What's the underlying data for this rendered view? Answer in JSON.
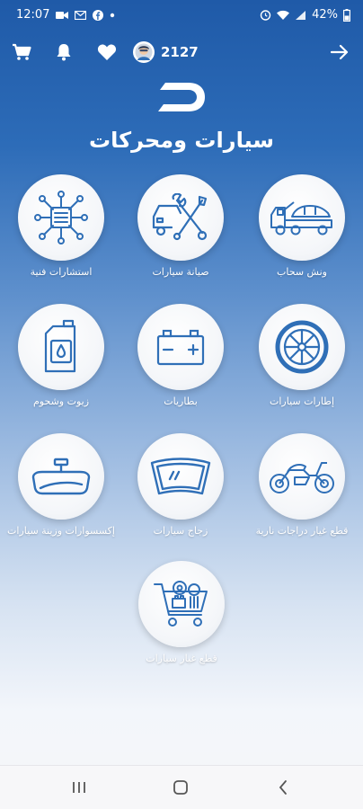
{
  "status": {
    "time": "12:07",
    "battery": "42%"
  },
  "header": {
    "points": "2127"
  },
  "page": {
    "title": "سيارات ومحركات"
  },
  "colors": {
    "accent": "#2d6cb8",
    "icon_stroke": "#2f6fb7",
    "white": "#ffffff"
  },
  "categories": [
    {
      "label": "ونش سحاب",
      "icon": "tow-truck-icon"
    },
    {
      "label": "صيانة سيارات",
      "icon": "car-repair-tools-icon"
    },
    {
      "label": "استشارات فنية",
      "icon": "circuit-chip-icon"
    },
    {
      "label": "إطارات سيارات",
      "icon": "tire-wheel-icon"
    },
    {
      "label": "بطاريات",
      "icon": "car-battery-icon"
    },
    {
      "label": "زيوت وشحوم",
      "icon": "oil-can-icon"
    },
    {
      "label": "قطع غيار دراجات نارية",
      "icon": "motorcycle-icon"
    },
    {
      "label": "زجاج سيارات",
      "icon": "windshield-icon"
    },
    {
      "label": "إكسسوارات وزينة سيارات",
      "icon": "rearview-mirror-icon"
    },
    {
      "label": "قطع غيار سيارات",
      "icon": "parts-cart-icon"
    }
  ]
}
